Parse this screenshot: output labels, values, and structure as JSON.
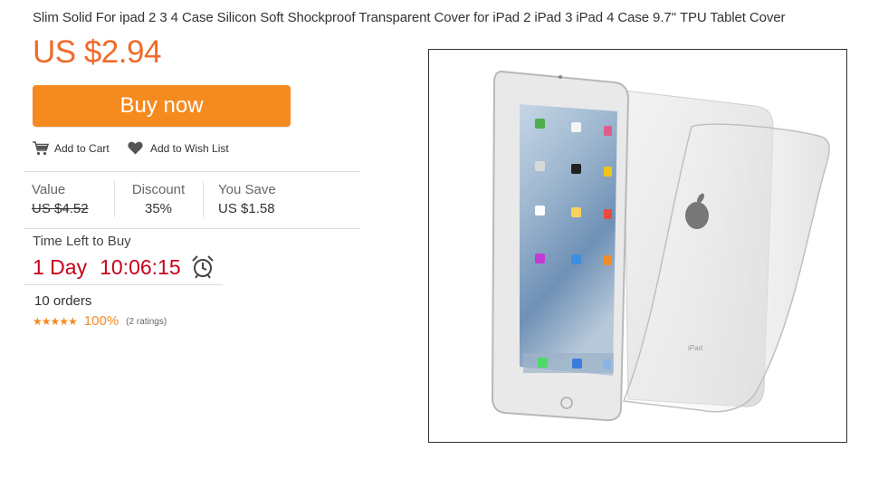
{
  "product": {
    "title": "Slim Solid For ipad 2 3 4 Case Silicon Soft Shockproof Transparent Cover for iPad 2 iPad 3 iPad 4 Case 9.7'' TPU Tablet Cover",
    "price": "US $2.94",
    "buy_label": "Buy now",
    "add_to_cart": "Add to Cart",
    "add_to_wishlist": "Add to Wish List",
    "value_label": "Value",
    "value": "US $4.52",
    "discount_label": "Discount",
    "discount": "35%",
    "you_save_label": "You Save",
    "you_save": "US $1.58",
    "time_left_label": "Time Left to Buy",
    "countdown_days": "1 Day",
    "countdown_time": "10:06:15",
    "orders": "10 orders",
    "rating_stars": "★★★★★",
    "rating_pct": "100%",
    "rating_count": "(2 ratings)",
    "image_text_back": "iPad"
  },
  "colors": {
    "accent_orange": "#f58a1f",
    "price_orange": "#f16b2a",
    "countdown_red": "#c8001b"
  },
  "icons": [
    "cart-icon",
    "heart-icon",
    "alarm-clock-icon"
  ]
}
